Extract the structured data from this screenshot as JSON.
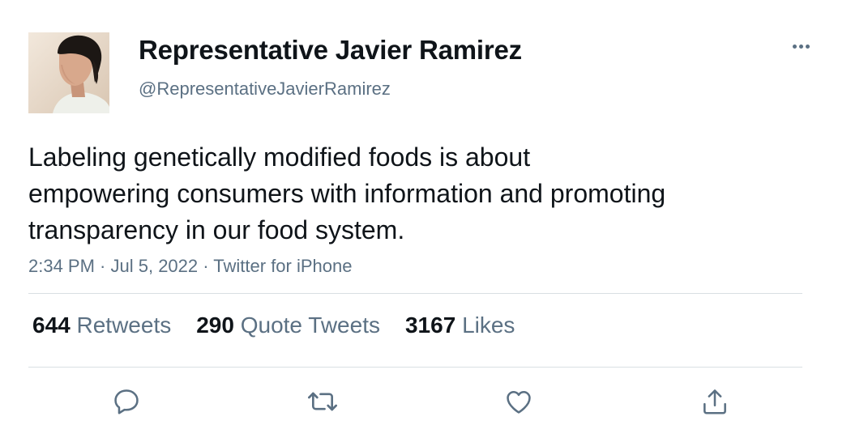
{
  "user": {
    "display_name": "Representative Javier Ramirez",
    "handle": "@RepresentativeJavierRamirez"
  },
  "tweet": {
    "lines": [
      "Labeling genetically modified foods is about",
      "empowering consumers with information and promoting",
      "transparency in our food system."
    ],
    "time": "2:34 PM",
    "date": "Jul 5, 2022",
    "source": "Twitter for iPhone",
    "separator": " · "
  },
  "stats": {
    "retweets": {
      "count": "644",
      "label": "Retweets"
    },
    "quotes": {
      "count": "290",
      "label": "Quote Tweets"
    },
    "likes": {
      "count": "3167",
      "label": "Likes"
    }
  },
  "icons": {
    "more": "more-horizontal-icon",
    "reply": "reply-icon",
    "retweet": "retweet-icon",
    "like": "heart-icon",
    "share": "share-icon"
  },
  "colors": {
    "text_primary": "#0f1419",
    "text_secondary": "#5b7083",
    "divider": "#d9dfe3"
  }
}
